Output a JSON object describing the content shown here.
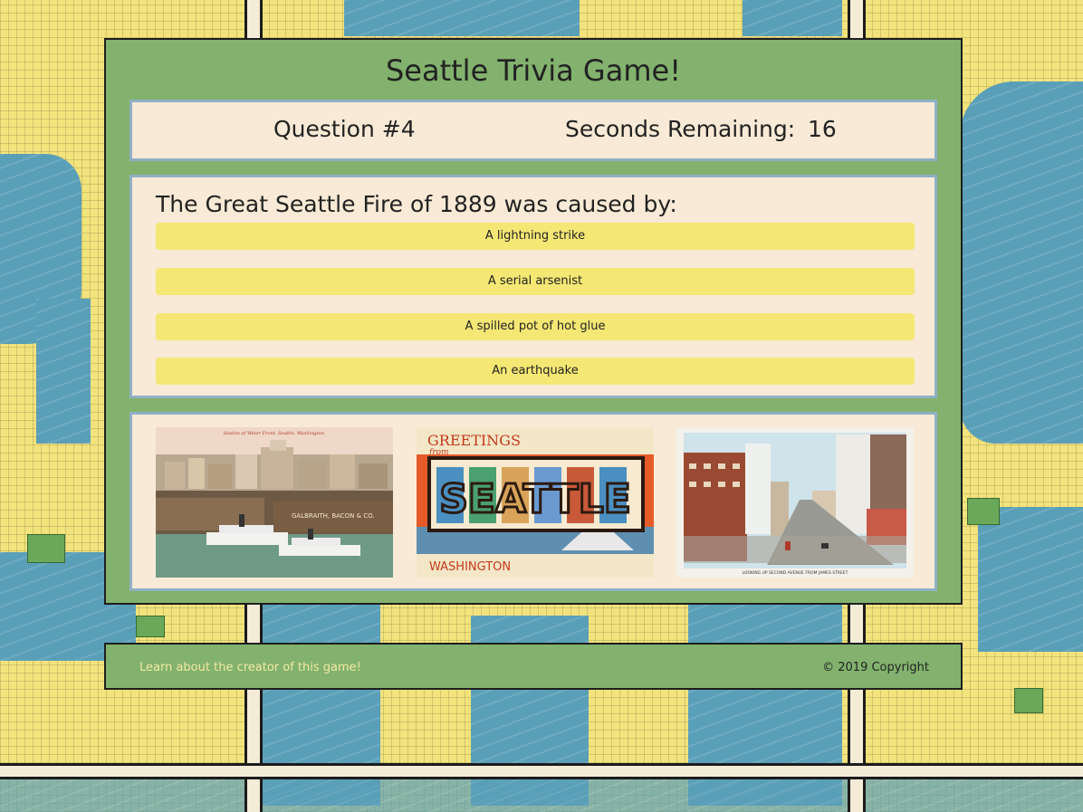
{
  "game": {
    "title": "Seattle Trivia Game!"
  },
  "status": {
    "question_label": "Question #4",
    "seconds_label": "Seconds Remaining:",
    "seconds_value": "16"
  },
  "question": {
    "text": "The Great Seattle Fire of 1889 was caused by:",
    "answers": [
      "A lightning strike",
      "A serial arsenist",
      "A spilled pot of hot glue",
      "An earthquake"
    ]
  },
  "postcards": [
    {
      "caption": "Station of Water Front, Seattle, Washington.",
      "sign": "GALBRAITH, BACON & CO."
    },
    {
      "greeting_top": "GREETINGS",
      "greeting_from": "from",
      "city": "SEATTLE",
      "state": "WASHINGTON"
    },
    {
      "caption": "LOOKING UP SECOND AVENUE FROM JAMES STREET"
    }
  ],
  "footer": {
    "creator_link": "Learn about the creator of this game!",
    "copyright": "© 2019 Copyright"
  },
  "colors": {
    "panel_green": "#82b26d",
    "box_cream": "#f8ead6",
    "answer_yellow": "#f5e774",
    "link_yellow": "#f3e9a3"
  }
}
